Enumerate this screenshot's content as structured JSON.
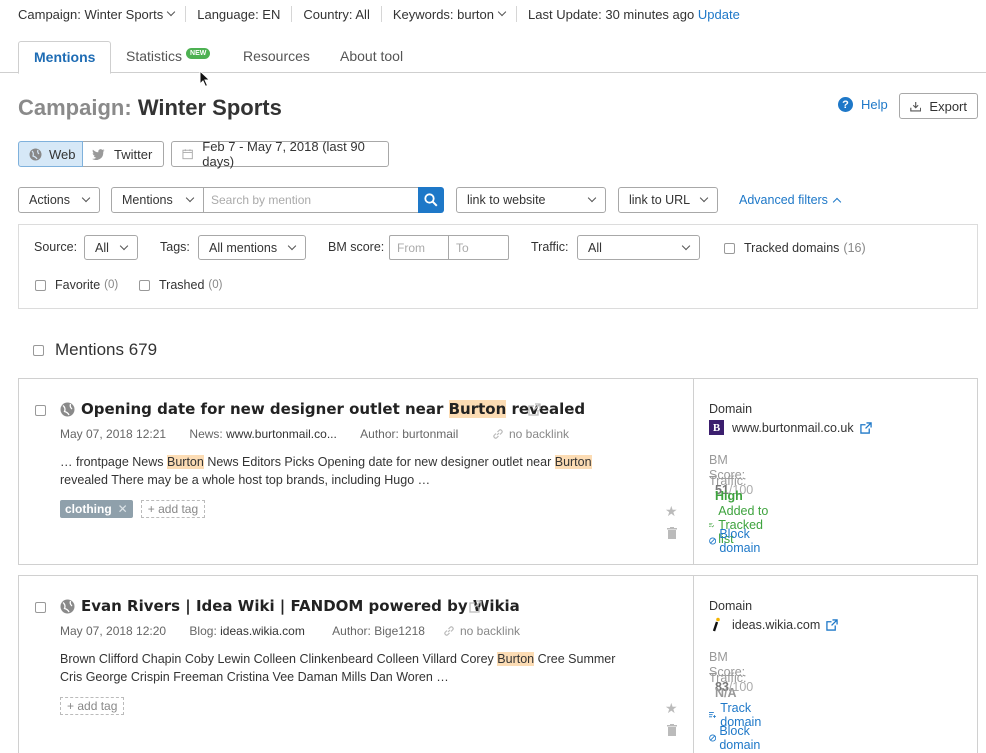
{
  "topbar": {
    "campaign": "Campaign: Winter Sports",
    "language": "Language: EN",
    "country": "Country: All",
    "keywords": "Keywords: burton",
    "last_update": "Last Update: 30 minutes ago",
    "update_link": "Update"
  },
  "tabs": [
    {
      "label": "Mentions"
    },
    {
      "label": "Statistics",
      "badge": "NEW"
    },
    {
      "label": "Resources"
    },
    {
      "label": "About tool"
    }
  ],
  "header": {
    "title_prefix": "Campaign:",
    "title_name": "Winter Sports",
    "help": "Help",
    "export": "Export"
  },
  "source_toggle": {
    "web": "Web",
    "twitter": "Twitter"
  },
  "date_range": "Feb 7 - May 7, 2018 (last 90 days)",
  "toolbar": {
    "actions": "Actions",
    "mentions_select": "Mentions",
    "search_placeholder": "Search by mention",
    "link_website": "link to website",
    "link_url": "link to URL",
    "advanced_filters": "Advanced filters"
  },
  "filters": {
    "source_label": "Source:",
    "source_value": "All",
    "tags_label": "Tags:",
    "tags_value": "All mentions",
    "bm_label": "BM score:",
    "bm_from": "From",
    "bm_to": "To",
    "traffic_label": "Traffic:",
    "traffic_value": "All",
    "tracked_domains": "Tracked domains",
    "tracked_count": "(16)",
    "favorite": "Favorite",
    "favorite_count": "(0)",
    "trashed": "Trashed",
    "trashed_count": "(0)"
  },
  "mentions_header": "Mentions 679",
  "mentions": [
    {
      "title_pre": "Opening date for new designer outlet near ",
      "title_hl": "Burton",
      "title_post": " revealed",
      "date": "May 07, 2018 12:21",
      "type_label": "News:",
      "type_value": "www.burtonmail.co...",
      "author_label": "Author:",
      "author_value": "burtonmail",
      "backlink": "no backlink",
      "snippet_1a": "… frontpage News ",
      "snippet_1b": "Burton",
      "snippet_1c": " News Editors Picks Opening date for new designer outlet near ",
      "snippet_1d": "Burton",
      "snippet_2": "revealed There may be a whole host top brands, including Hugo …",
      "tag": "clothing",
      "add_tag": "add tag",
      "domain_label": "Domain",
      "domain": "www.burtonmail.co.uk",
      "bm_label": "BM Score:",
      "bm_value": "51",
      "bm_max": "/100",
      "traffic_label": "Traffic:",
      "traffic_value": "High",
      "track_action": "Added to Tracked list",
      "block_action": "Block domain"
    },
    {
      "title_pre": "Evan Rivers | Idea Wiki | FANDOM powered by Wikia",
      "date": "May 07, 2018 12:20",
      "type_label": "Blog:",
      "type_value": "ideas.wikia.com",
      "author_label": "Author:",
      "author_value": "Bige1218",
      "backlink": "no backlink",
      "snippet_1a": "Brown Clifford Chapin Coby Lewin Colleen Clinkenbeard Colleen Villard Corey ",
      "snippet_1b": "Burton",
      "snippet_1c": " Cree Summer",
      "snippet_2": "Cris George Crispin Freeman Cristina Vee Daman Mills Dan Woren …",
      "add_tag": "add tag",
      "domain_label": "Domain",
      "domain": "ideas.wikia.com",
      "bm_label": "BM Score:",
      "bm_value": "83",
      "bm_max": "/100",
      "traffic_label": "Traffic:",
      "traffic_value": "N/A",
      "track_action": "Track domain",
      "block_action": "Block domain"
    }
  ],
  "colors": {
    "accent": "#1e78c8",
    "green": "#3ea33e",
    "highlight": "#fcdcb4",
    "tag": "#8fa0ab"
  }
}
